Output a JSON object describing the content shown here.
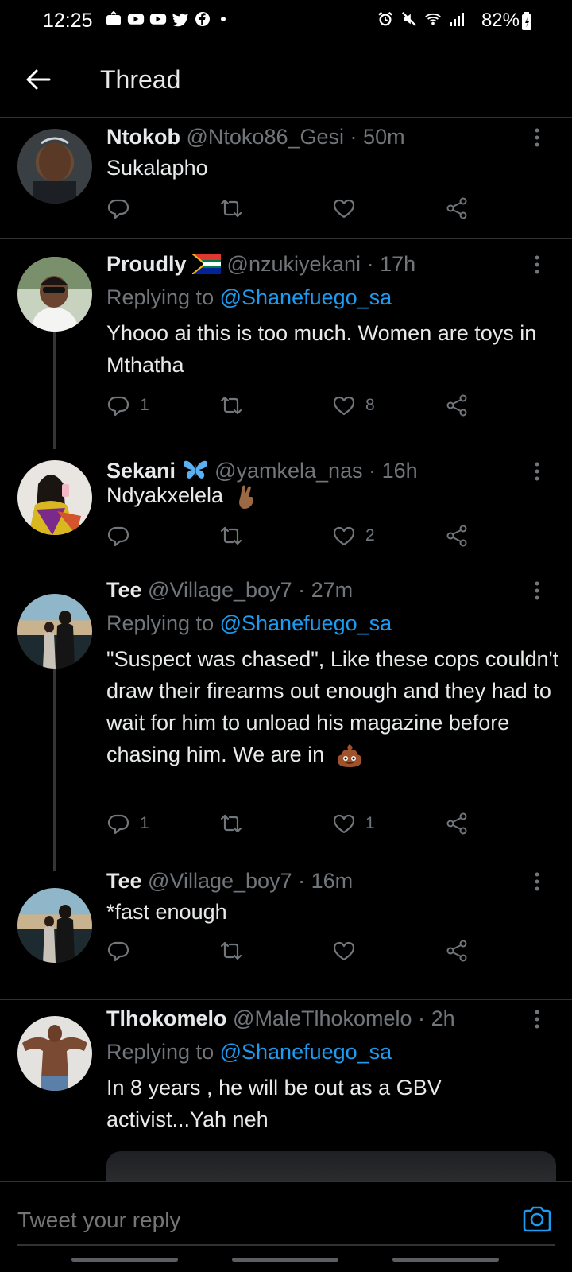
{
  "status_bar": {
    "time": "12:25",
    "battery": "82%"
  },
  "header": {
    "title": "Thread"
  },
  "tweets": [
    {
      "name": "Ntokob",
      "handle": "@Ntoko86_Gesi",
      "time": "50m",
      "replying_to": "",
      "text": "Sukalapho",
      "replies": "",
      "retweets": "",
      "likes": ""
    },
    {
      "name": "Proudly",
      "handle": "@nzukiyekani",
      "time": "17h",
      "replying_to": "@Shanefuego_sa",
      "text": "Yhooo ai this is too much. Women are toys in Mthatha",
      "replies": "1",
      "retweets": "",
      "likes": "8"
    },
    {
      "name": "Sekani",
      "handle": "@yamkela_nas",
      "time": "16h",
      "replying_to": "",
      "text": "Ndyakxelela",
      "replies": "",
      "retweets": "",
      "likes": "2"
    },
    {
      "name": "Tee",
      "handle": "@Village_boy7",
      "time": "27m",
      "replying_to": "@Shanefuego_sa",
      "text": "\"Suspect was chased\", Like these cops couldn't draw their firearms out enough and they had to wait for him to unload his magazine before chasing him. We are in",
      "replies": "1",
      "retweets": "",
      "likes": "1"
    },
    {
      "name": "Tee",
      "handle": "@Village_boy7",
      "time": "16m",
      "replying_to": "",
      "text": "*fast enough",
      "replies": "",
      "retweets": "",
      "likes": ""
    },
    {
      "name": "Tlhokomelo",
      "handle": "@MaleTlhokomelo",
      "time": "2h",
      "replying_to": "@Shanefuego_sa",
      "text": "In 8 years , he will be out as a GBV activist...Yah neh",
      "replies": "",
      "retweets": "",
      "likes": ""
    }
  ],
  "labels": {
    "replying_to": "Replying to"
  },
  "reply_bar": {
    "placeholder": "Tweet your reply"
  },
  "colors": {
    "background": "#000000",
    "accent": "#1d9bf0",
    "muted": "#71767b",
    "divider": "#2f3336"
  },
  "icons": [
    "back-arrow-icon",
    "more-icon",
    "reply-icon",
    "retweet-icon",
    "like-icon",
    "share-icon",
    "camera-icon",
    "flag-icon",
    "butterfly-icon",
    "crossed-fingers-emoji",
    "poo-emoji"
  ]
}
